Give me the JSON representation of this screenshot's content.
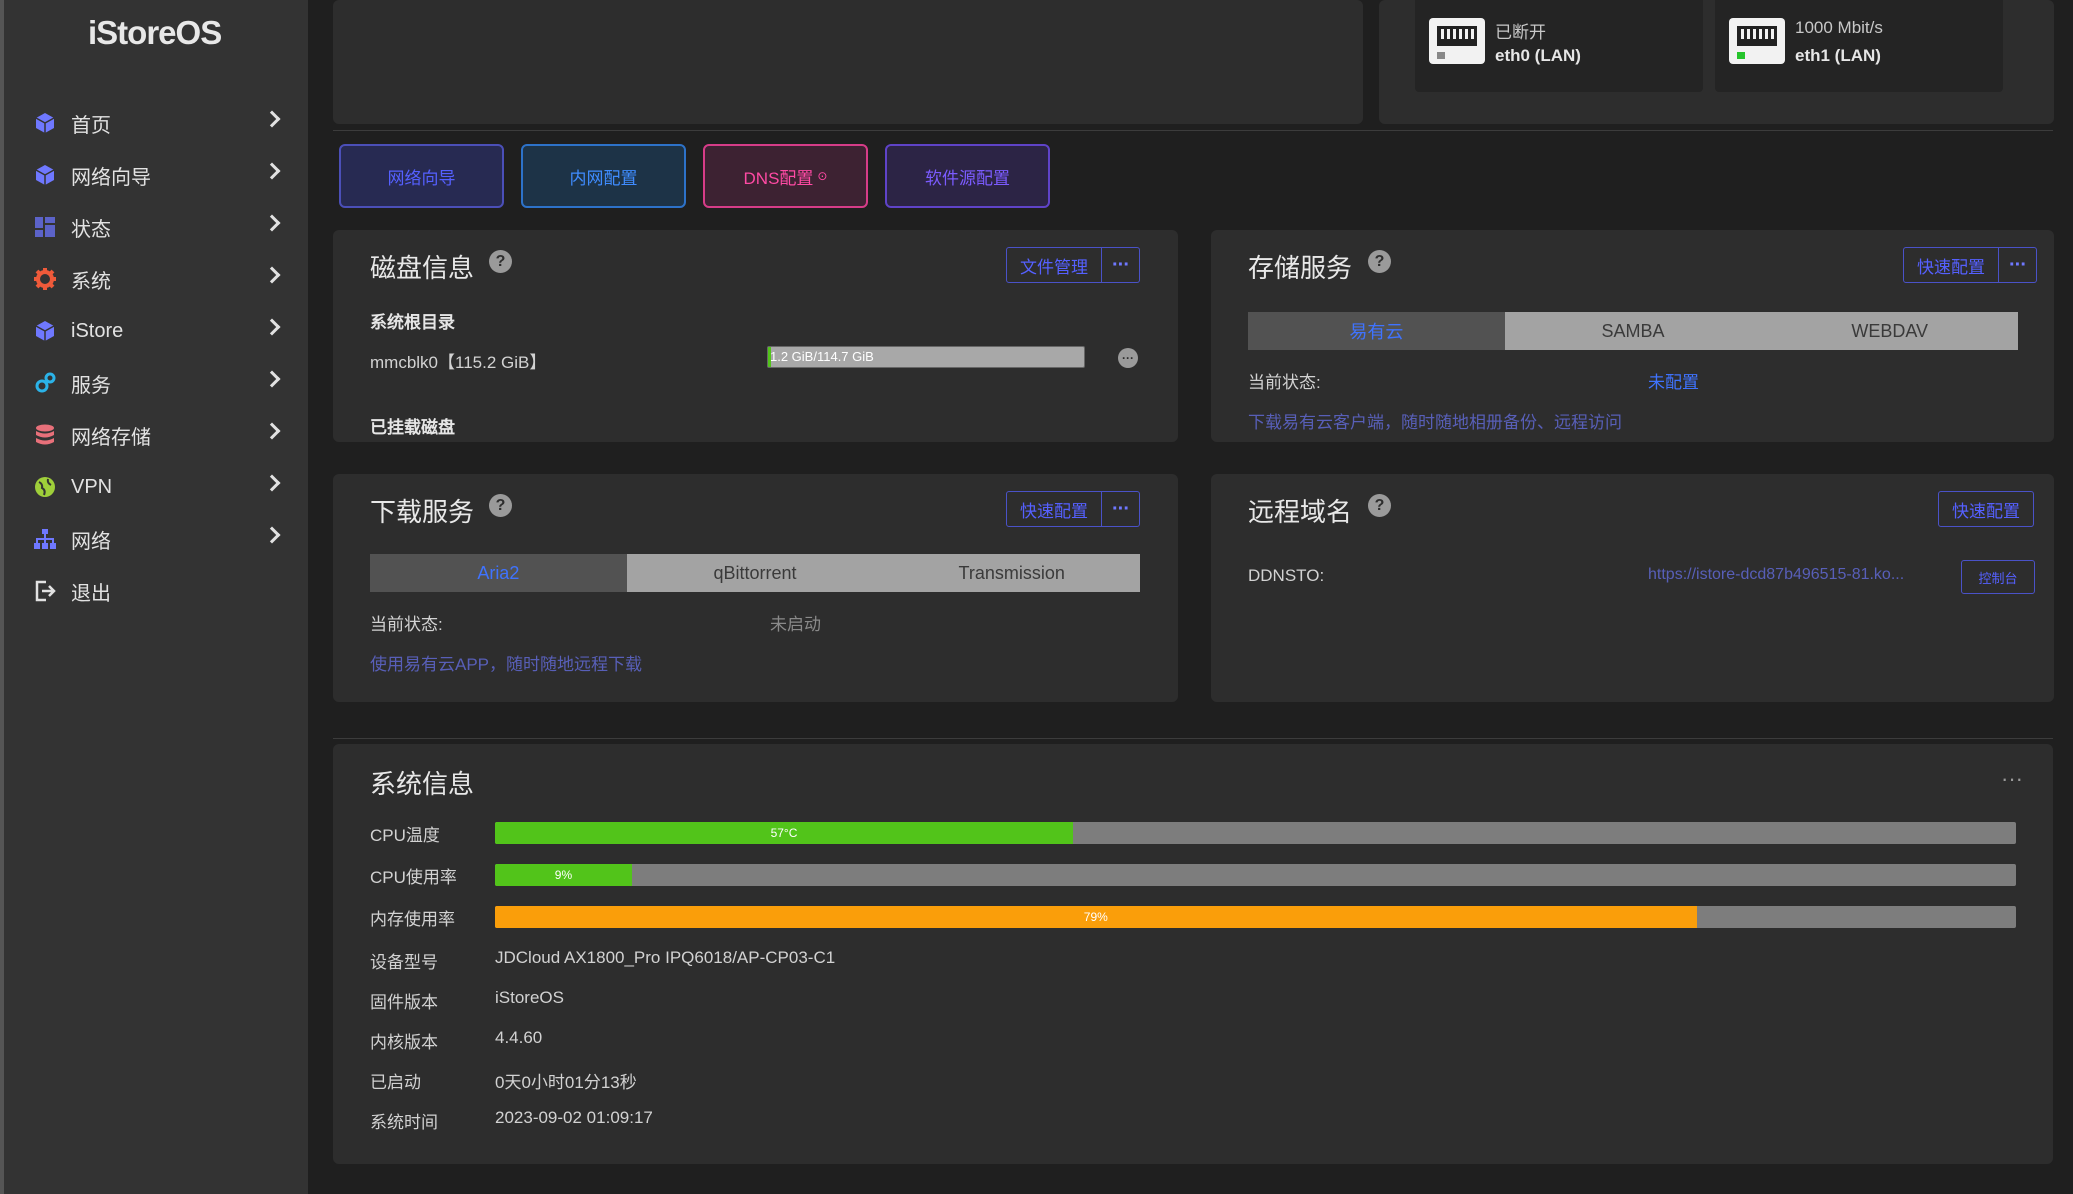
{
  "sidebar": {
    "logo": "iStoreOS",
    "items": [
      {
        "label": "首页",
        "icon": "cube-icon",
        "color": "#6f78ff"
      },
      {
        "label": "网络向导",
        "icon": "cube-icon",
        "color": "#6f78ff"
      },
      {
        "label": "状态",
        "icon": "dashboard-icon",
        "color": "#5c63c9"
      },
      {
        "label": "系统",
        "icon": "gear-icon",
        "color": "#ef5a3a"
      },
      {
        "label": "iStore",
        "icon": "cube-icon",
        "color": "#6f78ff"
      },
      {
        "label": "服务",
        "icon": "cogs-icon",
        "color": "#2bb3e8"
      },
      {
        "label": "网络存储",
        "icon": "database-icon",
        "color": "#e8707a"
      },
      {
        "label": "VPN",
        "icon": "globe-icon",
        "color": "#9fcf3a"
      },
      {
        "label": "网络",
        "icon": "sitemap-icon",
        "color": "#6f78ff"
      },
      {
        "label": "退出",
        "icon": "logout-icon",
        "color": "#e2e2e2"
      }
    ]
  },
  "ports": [
    {
      "status": "已断开",
      "name": "eth0 (LAN)",
      "connected": false
    },
    {
      "status": "1000 Mbit/s",
      "name": "eth1 (LAN)",
      "connected": true
    }
  ],
  "quick_buttons": [
    {
      "label": "网络向导",
      "border": "#4b4fb8",
      "bg": "#272a52",
      "color": "#5560ff"
    },
    {
      "label": "内网配置",
      "border": "#2d72c9",
      "bg": "#1d3347",
      "color": "#3f8cff"
    },
    {
      "label": "DNS配置",
      "border": "#d63c88",
      "bg": "#3d2232",
      "color": "#ff4aa4",
      "suffix": "⊙"
    },
    {
      "label": "软件源配置",
      "border": "#5f43c8",
      "bg": "#2c2445",
      "color": "#7b5bff"
    }
  ],
  "disk": {
    "title": "磁盘信息",
    "file_manager": "文件管理",
    "root_label": "系统根目录",
    "device": "mmcblk0【115.2 GiB】",
    "usage_text": "1.2 GiB/114.7 GiB",
    "usage_fraction": 0.011,
    "mounted_label": "已挂载磁盘"
  },
  "storage": {
    "title": "存储服务",
    "quick_config": "快速配置",
    "tabs": [
      "易有云",
      "SAMBA",
      "WEBDAV"
    ],
    "status_label": "当前状态:",
    "status_value": "未配置",
    "hint": "下载易有云客户端，随时随地相册备份、远程访问"
  },
  "download": {
    "title": "下载服务",
    "quick_config": "快速配置",
    "tabs": [
      "Aria2",
      "qBittorrent",
      "Transmission"
    ],
    "status_label": "当前状态:",
    "status_value": "未启动",
    "hint": "使用易有云APP，随时随地远程下载"
  },
  "ddns": {
    "title": "远程域名",
    "quick_config": "快速配置",
    "label": "DDNSTO:",
    "url": "https://istore-dcd87b496515-81.ko...",
    "console": "控制台"
  },
  "system": {
    "title": "系统信息",
    "more": "···",
    "bars": [
      {
        "label": "CPU温度",
        "text": "57°C",
        "fraction": 0.38,
        "color": "#52c41a"
      },
      {
        "label": "CPU使用率",
        "text": "9%",
        "fraction": 0.09,
        "color": "#52c41a"
      },
      {
        "label": "内存使用率",
        "text": "79%",
        "fraction": 0.79,
        "color": "#fa9e0a"
      }
    ],
    "rows": [
      {
        "label": "设备型号",
        "value": "JDCloud AX1800_Pro IPQ6018/AP-CP03-C1"
      },
      {
        "label": "固件版本",
        "value": "iStoreOS"
      },
      {
        "label": "内核版本",
        "value": "4.4.60"
      },
      {
        "label": "已启动",
        "value": "0天0小时01分13秒"
      },
      {
        "label": "系统时间",
        "value": "2023-09-02 01:09:17"
      }
    ]
  }
}
